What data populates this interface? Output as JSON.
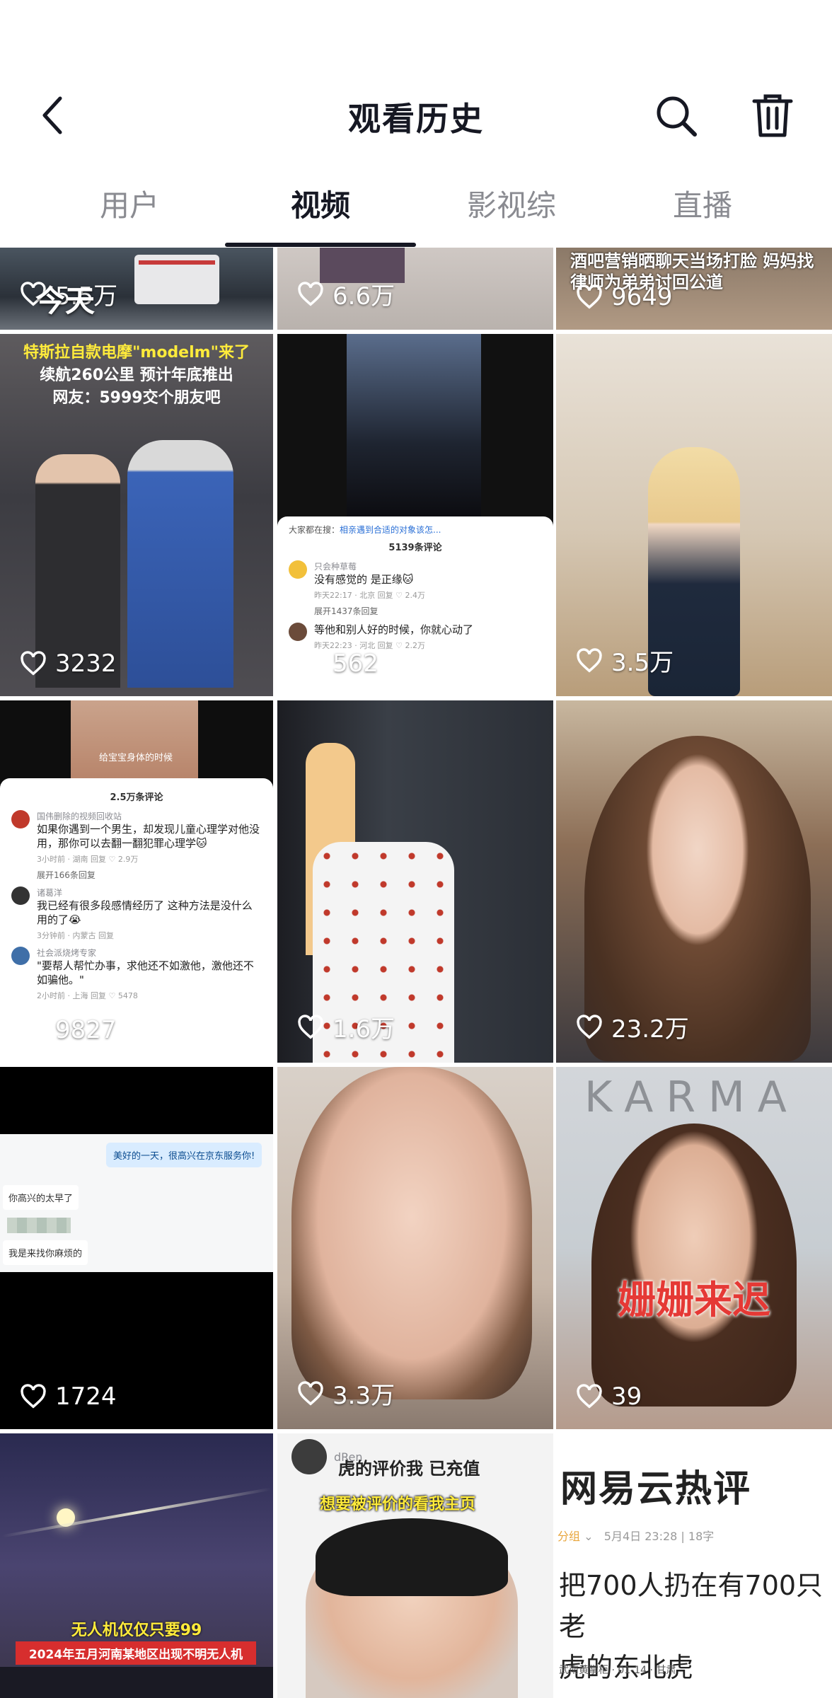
{
  "header": {
    "title": "观看历史",
    "back_icon": "chevron-left-icon",
    "search_icon": "search-icon",
    "delete_icon": "trash-icon"
  },
  "tabs": [
    {
      "label": "用户",
      "active": false
    },
    {
      "label": "视频",
      "active": true
    },
    {
      "label": "影视综",
      "active": false
    },
    {
      "label": "直播",
      "active": false
    }
  ],
  "section_label": "今天",
  "videos": [
    {
      "likes": "5.5万"
    },
    {
      "likes": "6.6万"
    },
    {
      "likes": "9649",
      "caption": "酒吧营销晒聊天当场打脸 妈妈找律师为弟弟讨回公道"
    },
    {
      "likes": "3232",
      "caption_line1": "特斯拉自款电摩\"modelm\"来了",
      "caption_line2": "续航260公里 预计年底推出",
      "caption_line3": "网友：5999交个朋友吧"
    },
    {
      "likes": "562",
      "search_hint_prefix": "大家都在搜：",
      "search_hint": "相亲遇到合适的对象该怎...",
      "comments_count": "5139条评论",
      "comments": [
        {
          "user": "只会种草莓",
          "text": "没有感觉的 是正缘🐱",
          "meta": "昨天22:17 · 北京  回复",
          "likes": "2.4万"
        },
        {
          "user": "",
          "text": "等他和别人好的时候，你就心动了",
          "meta": "昨天22:23 · 河北  回复",
          "likes": "2.2万"
        }
      ],
      "expand": "展开1437条回复"
    },
    {
      "likes": "3.5万"
    },
    {
      "likes": "9827",
      "caption_top": "给宝宝身体的时候",
      "comments_count": "2.5万条评论",
      "comments": [
        {
          "user": "国伟删除的视频回收站",
          "text": "如果你遇到一个男生，却发现儿童心理学对他没用，那你可以去翻一翻犯罪心理学🐱",
          "meta": "3小时前 · 湖南  回复",
          "likes": "2.9万"
        },
        {
          "user": "诸葛洋",
          "text": "我已经有很多段感情经历了 这种方法是没什么用的了😭",
          "meta": "3分钟前 · 内蒙古  回复",
          "likes": ""
        },
        {
          "user": "社会派烧烤专家",
          "text": "\"要帮人帮忙办事，求他还不如激他，激他还不如骗他。\"",
          "meta": "2小时前 · 上海  回复",
          "likes": "5478"
        }
      ],
      "expand": "展开166条回复"
    },
    {
      "likes": "1.6万"
    },
    {
      "likes": "23.2万"
    },
    {
      "likes": "1724",
      "chat_right": "美好的一天，很高兴在京东服务你!",
      "chat_left_1": "你高兴的太早了",
      "chat_left_2": "我是来找你麻烦的"
    },
    {
      "likes": "3.3万"
    },
    {
      "likes": "39",
      "brand": "KARMA",
      "caption": "姗姗来迟"
    },
    {
      "caption_line1": "无人机仅仅只要99",
      "caption_line2": "2024年五月河南某地区出现不明无人机"
    },
    {
      "user": "dRen",
      "caption_line1": "虎的评价我 已充值",
      "caption_line2": "想要被评价的看我主页"
    },
    {
      "title": "网易云热评",
      "meta_tag": "分组",
      "meta_time": "5月4日 23:28 | 18字",
      "body_line1": "把700人扔在有700只老",
      "body_line2": "虎的东北虎",
      "author": "武南黄掌柜 · 01-14 · 甘肃"
    }
  ],
  "colors": {
    "accent": "#161823",
    "muted": "#8a8b91",
    "like": "#ffffff"
  }
}
